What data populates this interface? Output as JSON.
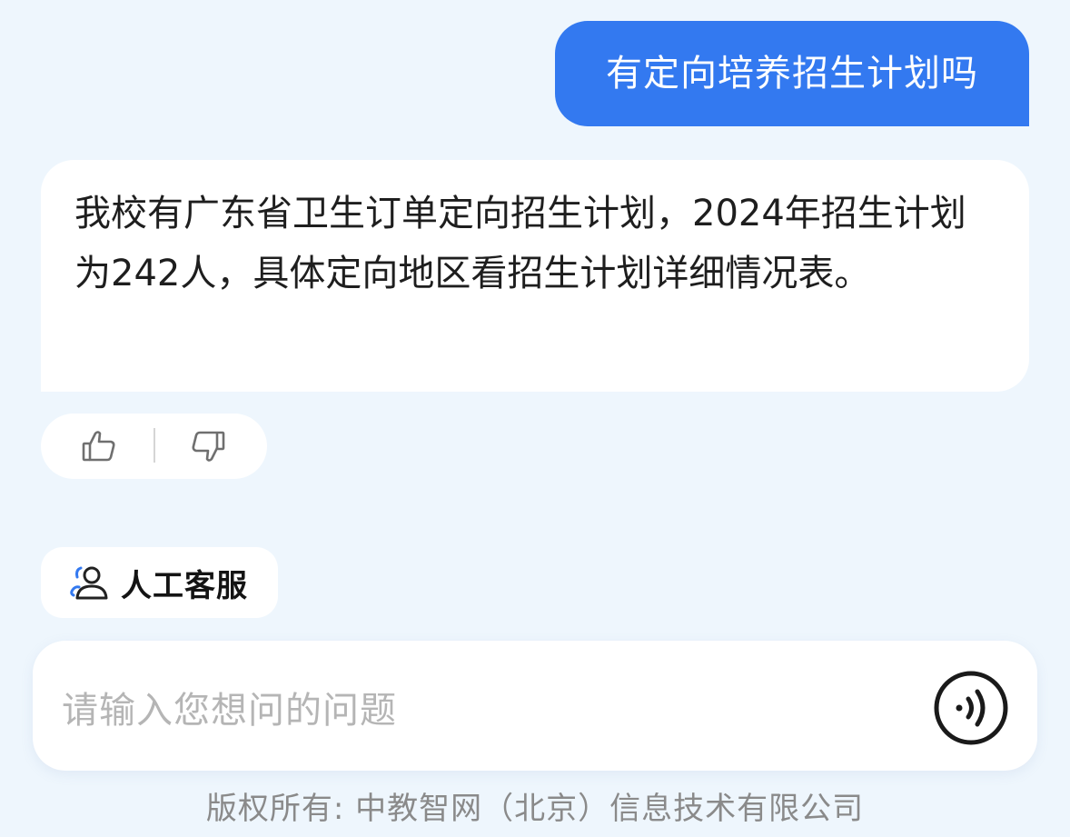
{
  "chat": {
    "user_message": "有定向培养招生计划吗",
    "bot_message": "我校有广东省卫生订单定向招生计划，2024年招生计划为242人，具体定向地区看招生计划详细情况表。"
  },
  "feedback": {
    "like_icon": "thumbs-up-icon",
    "dislike_icon": "thumbs-down-icon"
  },
  "human_service": {
    "label": "人工客服",
    "icon": "customer-service-icon"
  },
  "input": {
    "placeholder": "请输入您想问的问题",
    "voice_icon": "voice-input-icon"
  },
  "footer": {
    "copyright": "版权所有: 中教智网（北京）信息技术有限公司"
  },
  "colors": {
    "background": "#eef6fd",
    "user_bubble": "#3379f0",
    "accent": "#3379f0"
  }
}
